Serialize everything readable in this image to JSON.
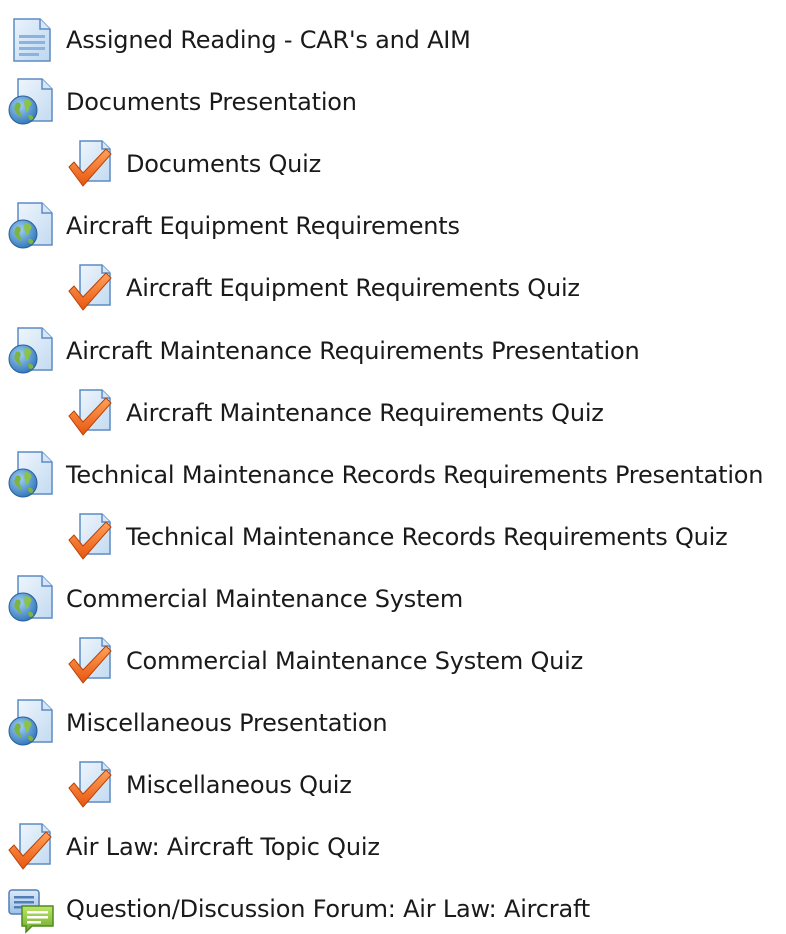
{
  "activities": [
    {
      "label": "Assigned Reading - CAR's and AIM",
      "icon": "page-icon",
      "indent": 0
    },
    {
      "label": "Documents Presentation",
      "icon": "url-icon",
      "indent": 0
    },
    {
      "label": "Documents Quiz",
      "icon": "quiz-icon",
      "indent": 1
    },
    {
      "label": "Aircraft Equipment Requirements",
      "icon": "url-icon",
      "indent": 0
    },
    {
      "label": "Aircraft Equipment Requirements Quiz",
      "icon": "quiz-icon",
      "indent": 1
    },
    {
      "label": "Aircraft Maintenance Requirements Presentation",
      "icon": "url-icon",
      "indent": 0
    },
    {
      "label": "Aircraft Maintenance Requirements Quiz",
      "icon": "quiz-icon",
      "indent": 1
    },
    {
      "label": "Technical Maintenance Records Requirements Presentation",
      "icon": "url-icon",
      "indent": 0
    },
    {
      "label": "Technical Maintenance Records Requirements Quiz",
      "icon": "quiz-icon",
      "indent": 1
    },
    {
      "label": "Commercial Maintenance System",
      "icon": "url-icon",
      "indent": 0
    },
    {
      "label": "Commercial Maintenance System Quiz",
      "icon": "quiz-icon",
      "indent": 1
    },
    {
      "label": "Miscellaneous Presentation",
      "icon": "url-icon",
      "indent": 0
    },
    {
      "label": "Miscellaneous Quiz",
      "icon": "quiz-icon",
      "indent": 1
    },
    {
      "label": "Air Law: Aircraft Topic Quiz",
      "icon": "quiz-icon",
      "indent": 0
    },
    {
      "label": "Question/Discussion Forum: Air Law: Aircraft",
      "icon": "forum-icon",
      "indent": 0
    }
  ]
}
